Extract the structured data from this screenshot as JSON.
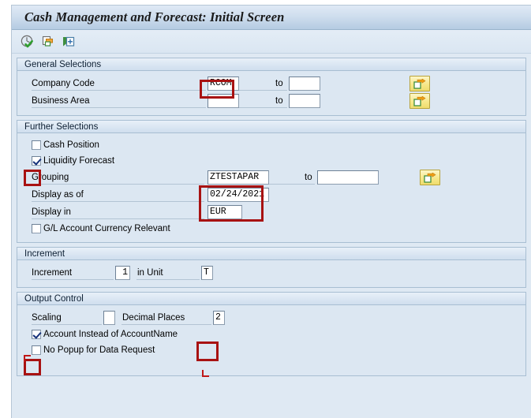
{
  "window": {
    "title": "Cash Management and Forecast: Initial Screen"
  },
  "toolbar": {
    "buttons": [
      {
        "name": "execute-clock-check-icon",
        "tooltip": "Execute"
      },
      {
        "name": "copy-variant-icon",
        "tooltip": "Get Variant"
      },
      {
        "name": "save-variant-icon",
        "tooltip": "Save as Variant"
      }
    ]
  },
  "sections": {
    "general_selections": {
      "title": "General Selections",
      "company_code": {
        "label": "Company Code",
        "value": "RCOM",
        "to_label": "to",
        "to_value": "",
        "multi_select_icon": "multi-selection-arrow-icon"
      },
      "business_area": {
        "label": "Business Area",
        "value": "",
        "to_label": "to",
        "to_value": "",
        "multi_select_icon": "multi-selection-arrow-icon"
      }
    },
    "further_selections": {
      "title": "Further Selections",
      "cash_position": {
        "label": "Cash Position",
        "checked": false
      },
      "liquidity_forecast": {
        "label": "Liquidity Forecast",
        "checked": true
      },
      "grouping": {
        "label": "Grouping",
        "value": "ZTESTAPAR",
        "to_label": "to",
        "to_value": "",
        "multi_select_icon": "multi-selection-arrow-icon"
      },
      "display_as_of": {
        "label": "Display as of",
        "value": "02/24/2021"
      },
      "display_in": {
        "label": "Display in",
        "value": "EUR"
      },
      "gl_account_currency_relevant": {
        "label": "G/L Account Currency Relevant",
        "checked": false
      }
    },
    "increment": {
      "title": "Increment",
      "increment": {
        "label": "Increment",
        "value": "1"
      },
      "in_unit": {
        "label": "in Unit",
        "value": "T"
      }
    },
    "output_control": {
      "title": "Output Control",
      "scaling": {
        "label": "Scaling",
        "value": ""
      },
      "decimal_places": {
        "label": "Decimal Places",
        "value": "2"
      },
      "account_instead_of_accountname": {
        "label": "Account Instead of AccountName",
        "checked": true
      },
      "no_popup_for_data_request": {
        "label": "No Popup for Data Request",
        "checked": false
      }
    }
  },
  "annotations": {
    "highlight_color": "#a81212",
    "boxes": [
      {
        "name": "highlight-company-code"
      },
      {
        "name": "highlight-liquidity-forecast-checkbox"
      },
      {
        "name": "highlight-grouping-and-date"
      },
      {
        "name": "highlight-decimal-places"
      },
      {
        "name": "highlight-account-instead-checkbox"
      }
    ]
  }
}
